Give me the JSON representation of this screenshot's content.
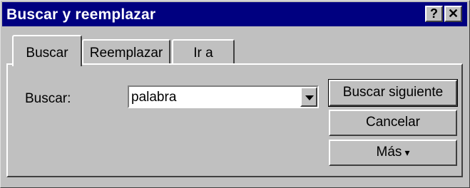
{
  "window": {
    "title": "Buscar y reemplazar",
    "help_label": "?",
    "close_label": "✕"
  },
  "tabs": [
    {
      "label": "Buscar",
      "active": true
    },
    {
      "label": "Reemplazar",
      "active": false
    },
    {
      "label": "Ir a",
      "active": false
    }
  ],
  "find": {
    "label": "Buscar:",
    "value": "palabra"
  },
  "buttons": {
    "find_next": "Buscar siguiente",
    "cancel": "Cancelar",
    "more": "Más",
    "more_icon": "double-chevron-down"
  }
}
